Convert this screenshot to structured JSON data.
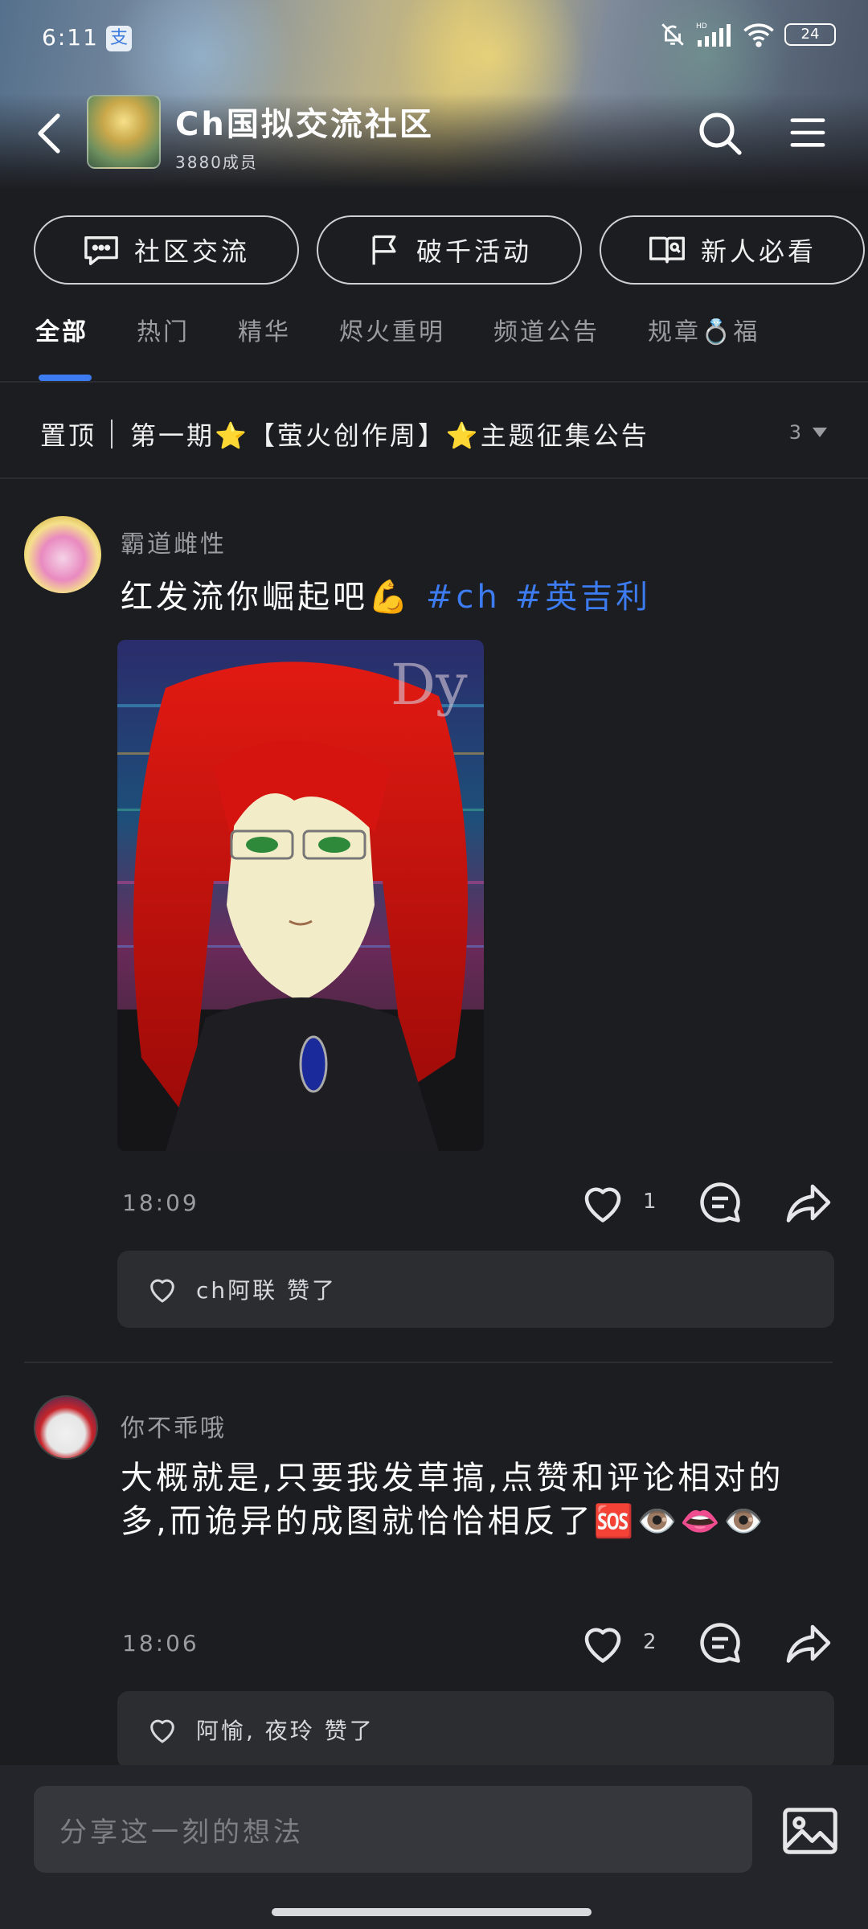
{
  "status": {
    "time": "6:11",
    "app_badge": "支",
    "battery": "24",
    "network": "HD"
  },
  "community": {
    "name": "Ch国拟交流社区",
    "members": "3880成员"
  },
  "shortcuts": [
    {
      "label": "社区交流",
      "icon": "chat-icon"
    },
    {
      "label": "破千活动",
      "icon": "flag-icon"
    },
    {
      "label": "新人必看",
      "icon": "guide-book-icon"
    }
  ],
  "tabs": [
    "全部",
    "热门",
    "精华",
    "烬火重明",
    "频道公告",
    "规章💍福"
  ],
  "pinned": {
    "tag": "置顶",
    "text": "第一期⭐【萤火创作周】⭐主题征集公告",
    "count": "3"
  },
  "posts": [
    {
      "author": "霸道雌性",
      "text": "红发流你崛起吧💪",
      "tags": [
        "#ch",
        "#英吉利"
      ],
      "time": "18:09",
      "likes": "1",
      "liked_by": "ch阿联 赞了"
    },
    {
      "author": "你不乖哦",
      "text": "大概就是,只要我发草搞,点赞和评论相对的多,而诡异的成图就恰恰相反了🆘👁️👄👁️",
      "time": "18:06",
      "likes": "2",
      "liked_by": "阿愉, 夜玲 赞了"
    }
  ],
  "composer": {
    "placeholder": "分享这一刻的想法"
  },
  "colors": {
    "accent": "#3d7bf0",
    "background": "#1c1d21"
  }
}
